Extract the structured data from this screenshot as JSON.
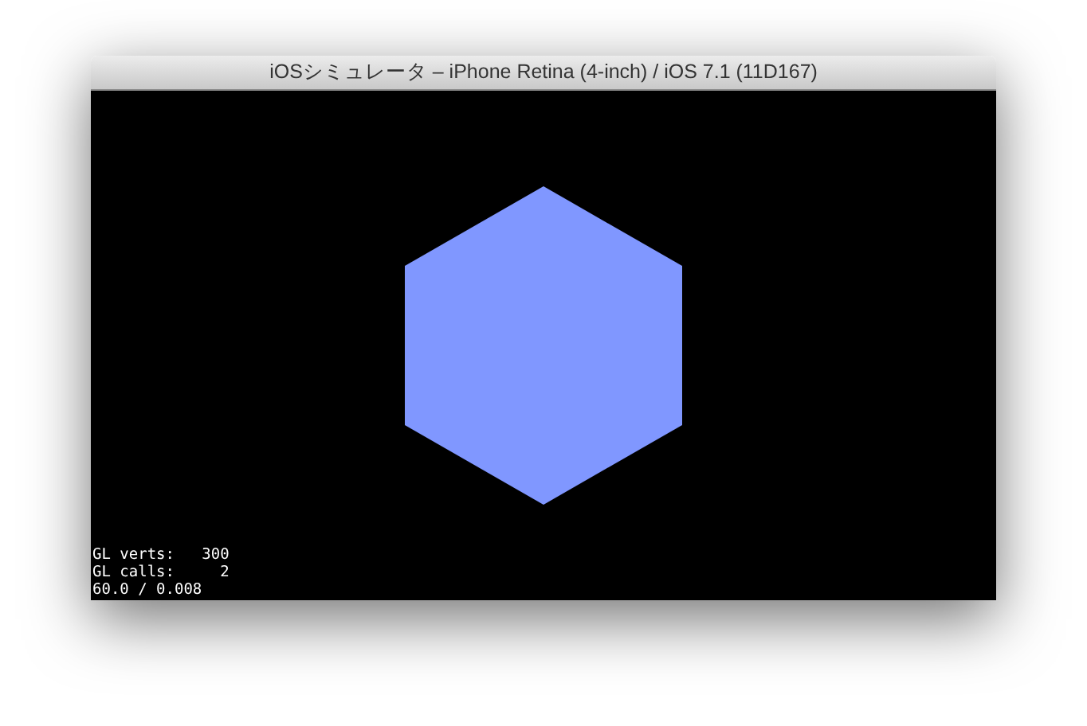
{
  "window": {
    "title": "iOSシミュレータ – iPhone Retina (4-inch) / iOS 7.1 (11D167)"
  },
  "debug_overlay": [
    "GL verts:   300",
    "GL calls:     2",
    "60.0 / 0.008"
  ]
}
